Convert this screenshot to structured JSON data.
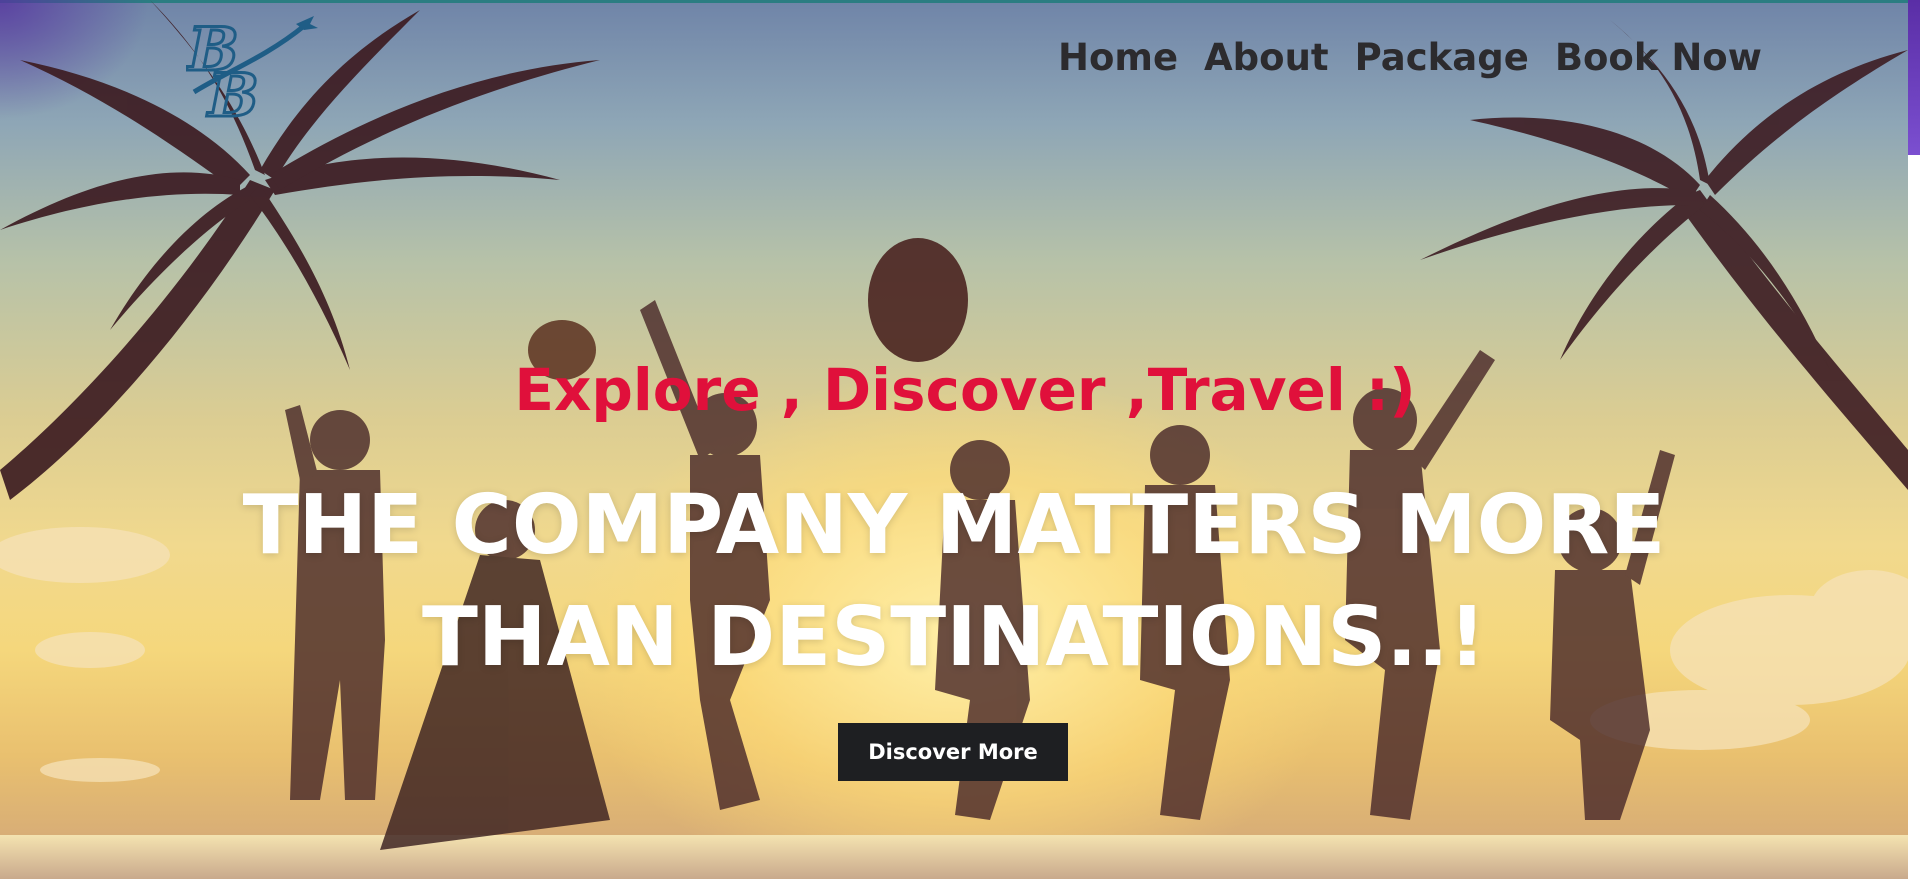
{
  "nav": {
    "items": [
      {
        "label": "Home"
      },
      {
        "label": "About"
      },
      {
        "label": "Package"
      },
      {
        "label": "Book Now"
      }
    ]
  },
  "hero": {
    "tagline": "Explore , Discover ,Travel :)",
    "headline_line1": "THE COMPANY MATTERS MORE",
    "headline_line2": "THAN DESTINATIONS..!",
    "cta_label": "Discover More"
  },
  "colors": {
    "nav_text": "#2c2b2e",
    "tagline": "#e0103b",
    "headline": "#ffffff",
    "button_bg": "#1e1f22",
    "logo": "#1f5d86"
  },
  "icons": {
    "logo": "bb-airplane-logo"
  }
}
